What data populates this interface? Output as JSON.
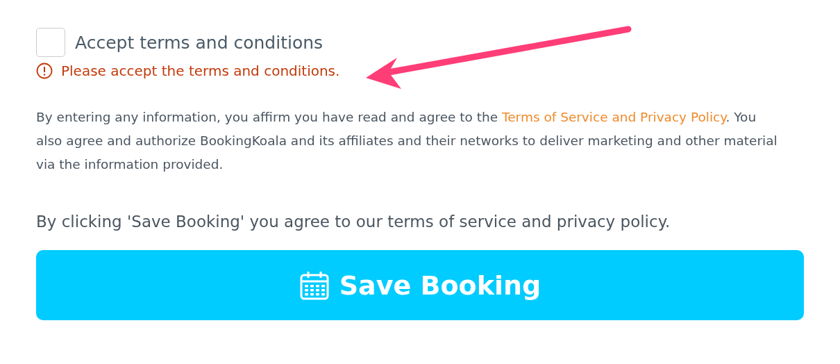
{
  "terms": {
    "label": "Accept terms and conditions",
    "checked": false
  },
  "error": {
    "text": "Please accept the terms and conditions."
  },
  "disclaimer": {
    "before": "By entering any information, you affirm you have read and agree to the ",
    "link": "Terms of Service and Privacy Policy",
    "after": ". You also agree and authorize BookingKoala and its affiliates and their networks to deliver marketing and other material via the information provided."
  },
  "agreement": "By clicking 'Save Booking' you agree to our terms of service and privacy policy.",
  "save_button": {
    "label": "Save Booking"
  }
}
